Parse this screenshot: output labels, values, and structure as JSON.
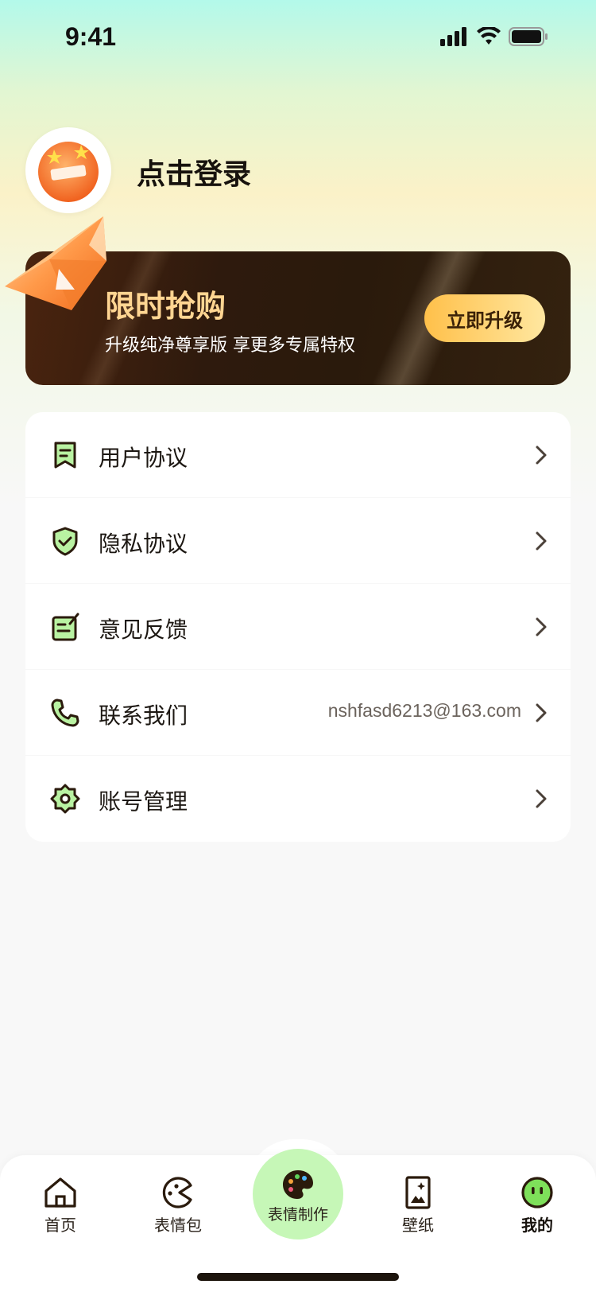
{
  "status_bar": {
    "time": "9:41"
  },
  "header": {
    "login_text": "点击登录"
  },
  "promo": {
    "title": "限时抢购",
    "subtitle": "升级纯净尊享版 享更多专属特权",
    "button_label": "立即升级"
  },
  "menu": {
    "items": [
      {
        "label": "用户协议",
        "icon": "bookmark-document-icon",
        "value": ""
      },
      {
        "label": "隐私协议",
        "icon": "shield-check-icon",
        "value": ""
      },
      {
        "label": "意见反馈",
        "icon": "feedback-edit-icon",
        "value": ""
      },
      {
        "label": "联系我们",
        "icon": "phone-icon",
        "value": "nshfasd6213@163.com"
      },
      {
        "label": "账号管理",
        "icon": "gear-icon",
        "value": ""
      }
    ]
  },
  "tabs": [
    {
      "label": "首页",
      "icon": "home-icon"
    },
    {
      "label": "表情包",
      "icon": "pacman-icon"
    },
    {
      "label": "表情制作",
      "icon": "palette-icon"
    },
    {
      "label": "壁纸",
      "icon": "wallpaper-icon"
    },
    {
      "label": "我的",
      "icon": "smiley-icon",
      "active": true
    }
  ],
  "colors": {
    "accent_green": "#c6f7b7",
    "promo_gold": "#ffd592",
    "promo_button": "#ffc04a",
    "dark_brown": "#2a1a0c"
  }
}
